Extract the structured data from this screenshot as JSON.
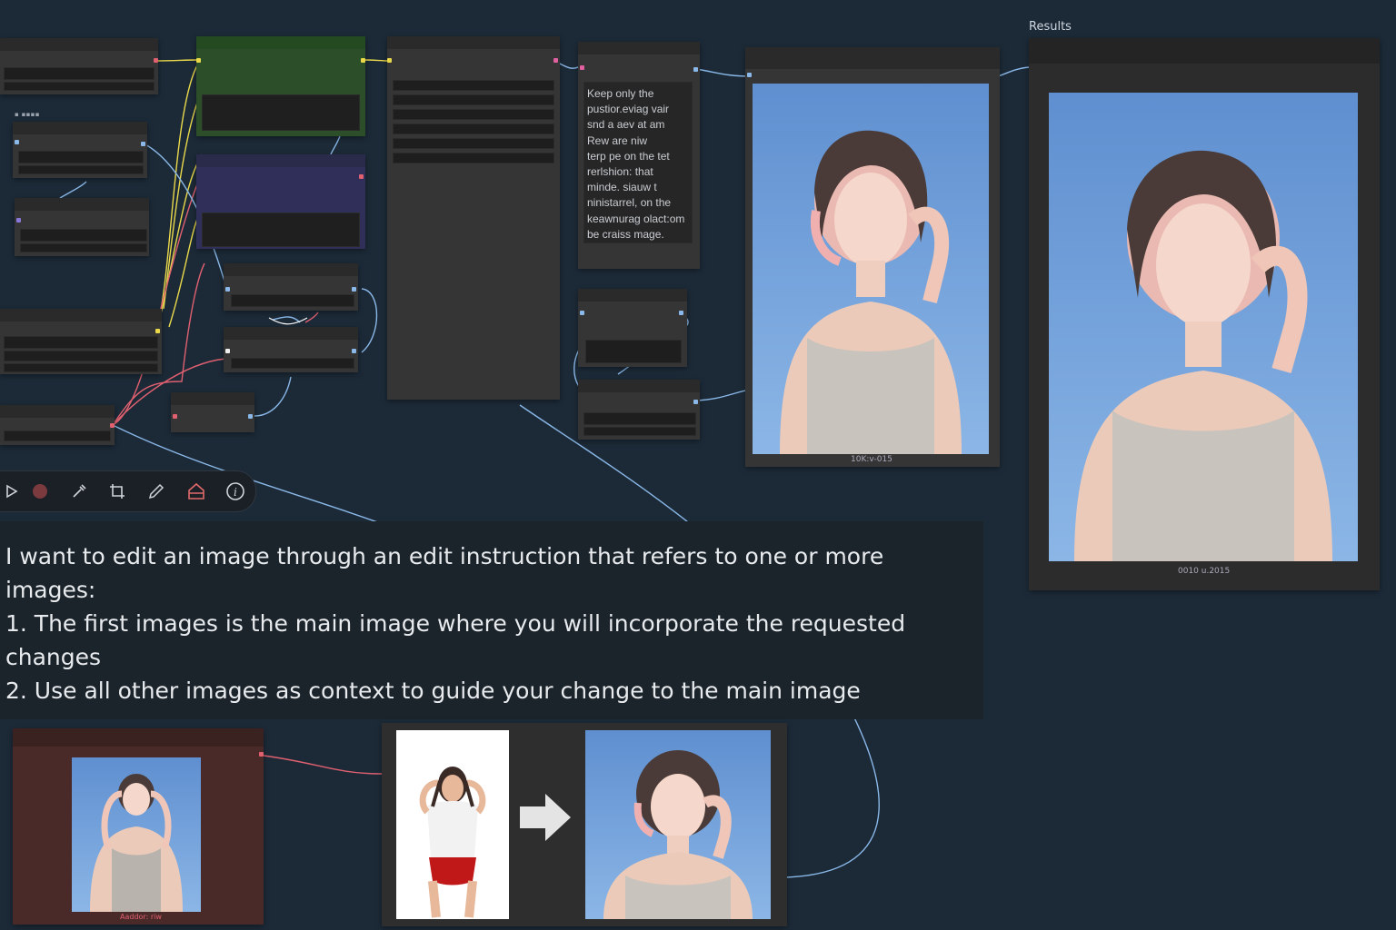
{
  "results_panel": {
    "title": "Results",
    "caption": "0010 u.2015"
  },
  "preview_node": {
    "caption": "10K:v-015"
  },
  "prompt_node": {
    "lines": [
      "Keep only the",
      "pustior.eviag vair",
      "snd a aev at am",
      "Rew are niw",
      "terp pe on the tet",
      "rerlshion: that",
      "minde. siauw t",
      "ninistarrel, on the",
      "keawnurag olact:om",
      "be craiss mage."
    ]
  },
  "load_image_node": {
    "caption": "Aaddor: riw"
  },
  "instruction": {
    "lines": [
      "I want to edit an image through an edit instruction that refers to one or more images:",
      "1. The first images is the main image where you will incorporate the requested changes",
      "2. Use all other images as context to guide your change to the main image"
    ]
  },
  "toolbar": {
    "icons": [
      "play-icon",
      "record-dot-icon",
      "eyedropper-icon",
      "crop-icon",
      "pencil-icon",
      "home-icon",
      "info-icon"
    ],
    "colors": {
      "record": "#7a3a3e",
      "home": "#e06a6a"
    }
  },
  "colors": {
    "canvas": "#1c2a38",
    "node": "#353535",
    "green_node": "#2c4f2a",
    "purple_node": "#2f2f5a",
    "red_node": "#4a2a28",
    "wire_yellow": "#e8d84a",
    "wire_red": "#e06070",
    "wire_blue": "#8ab8e8"
  }
}
